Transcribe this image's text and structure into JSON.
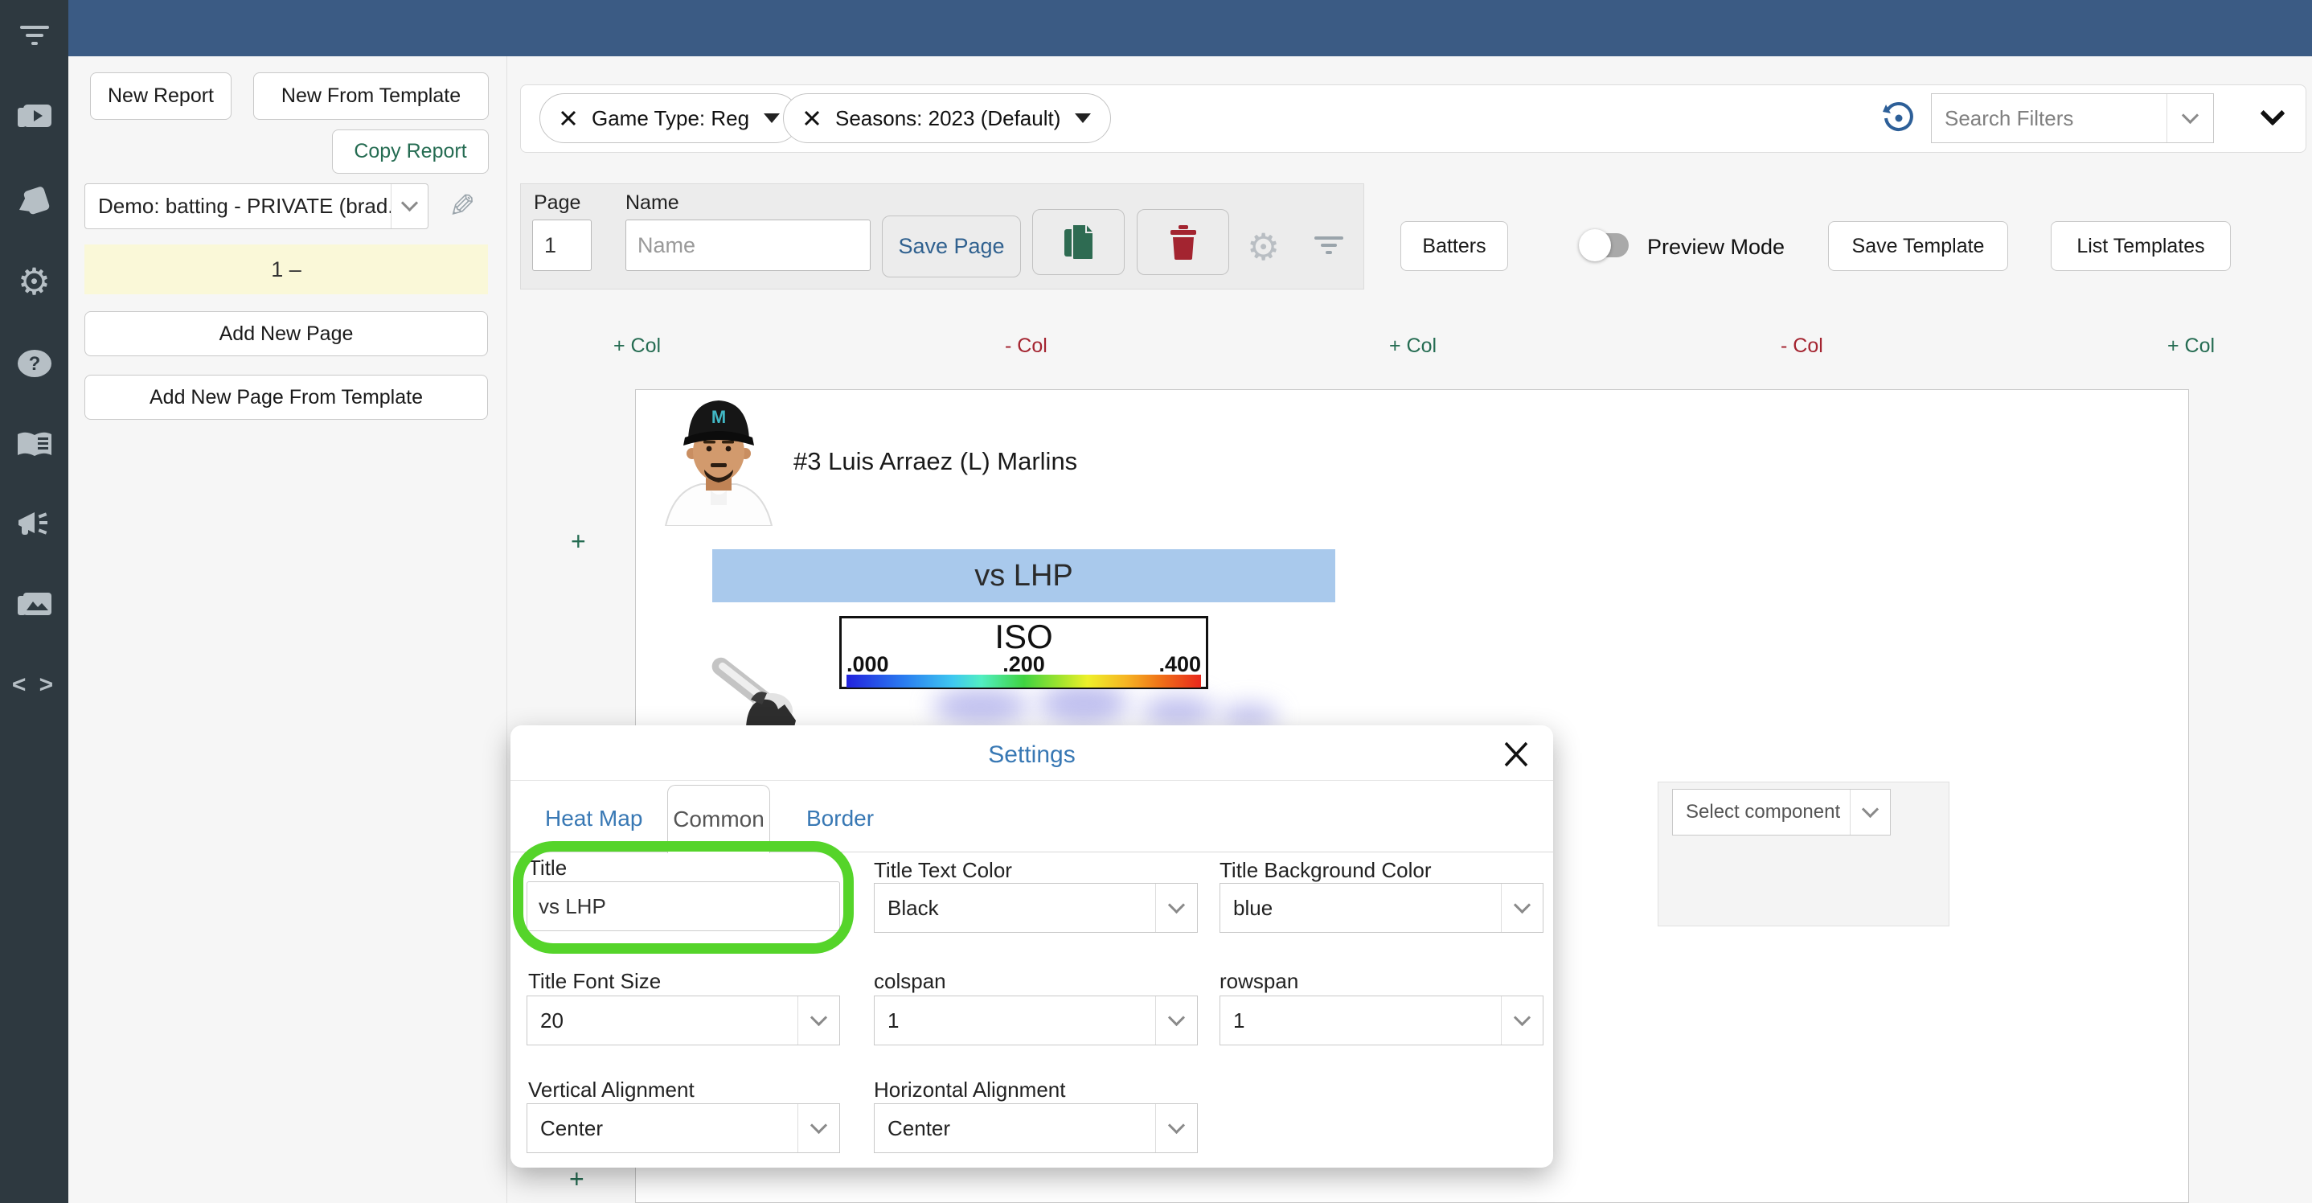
{
  "colors": {
    "topbar_blue": "#3b5b84",
    "sidebar_dark": "#2e3940",
    "accent_green": "#256c52",
    "accent_red": "#a42430",
    "link_blue": "#3878b4",
    "save_page_blue": "#30618f",
    "section_header_blue": "#a9c9ec",
    "highlight_green": "#55d42a",
    "page_highlight_yellow": "#faf8d8"
  },
  "sidebar": {
    "icons": [
      {
        "name": "filter"
      },
      {
        "name": "video-library"
      },
      {
        "name": "cards"
      },
      {
        "name": "settings-gear"
      },
      {
        "name": "help"
      },
      {
        "name": "handbook"
      },
      {
        "name": "announcements"
      },
      {
        "name": "image-library"
      },
      {
        "name": "code"
      }
    ]
  },
  "left_panel": {
    "new_report": "New Report",
    "new_from_template": "New From Template",
    "copy_report": "Copy Report",
    "report_select_value": "Demo: batting - PRIVATE (brad...",
    "page_indicator": "1 –",
    "add_new_page": "Add New Page",
    "add_new_page_from_template": "Add New Page From Template"
  },
  "filter_bar": {
    "chips": [
      {
        "label": "Game Type: Reg"
      },
      {
        "label": "Seasons: 2023 (Default)"
      }
    ],
    "search_filters_placeholder": "Search Filters"
  },
  "page_toolbar": {
    "page_label": "Page",
    "page_value": "1",
    "name_label": "Name",
    "name_placeholder": "Name",
    "save_page": "Save Page",
    "batters": "Batters",
    "preview_mode": "Preview Mode",
    "preview_mode_on": false,
    "save_template": "Save Template",
    "list_templates": "List Templates"
  },
  "column_controls": [
    "+ Col",
    "- Col",
    "+ Col",
    "- Col",
    "+ Col"
  ],
  "report": {
    "player": "#3 Luis Arraez (L) Marlins",
    "add_row_left": "+",
    "add_row_bottom": "+",
    "section_title": "vs LHP",
    "legend": {
      "metric": "ISO",
      "ticks": [
        ".000",
        ".200",
        ".400"
      ]
    }
  },
  "component_picker": {
    "placeholder": "Select component"
  },
  "settings_modal": {
    "title": "Settings",
    "tabs": [
      {
        "label": "Heat Map"
      },
      {
        "label": "Common"
      },
      {
        "label": "Border"
      }
    ],
    "fields": {
      "title": {
        "label": "Title",
        "value": "vs LHP"
      },
      "title_text_color": {
        "label": "Title Text Color",
        "value": "Black"
      },
      "title_background_color": {
        "label": "Title Background Color",
        "value": "blue"
      },
      "title_font_size": {
        "label": "Title Font Size",
        "value": "20"
      },
      "colspan": {
        "label": "colspan",
        "value": "1"
      },
      "rowspan": {
        "label": "rowspan",
        "value": "1"
      },
      "vertical_alignment": {
        "label": "Vertical Alignment",
        "value": "Center"
      },
      "horizontal_alignment": {
        "label": "Horizontal Alignment",
        "value": "Center"
      }
    }
  }
}
